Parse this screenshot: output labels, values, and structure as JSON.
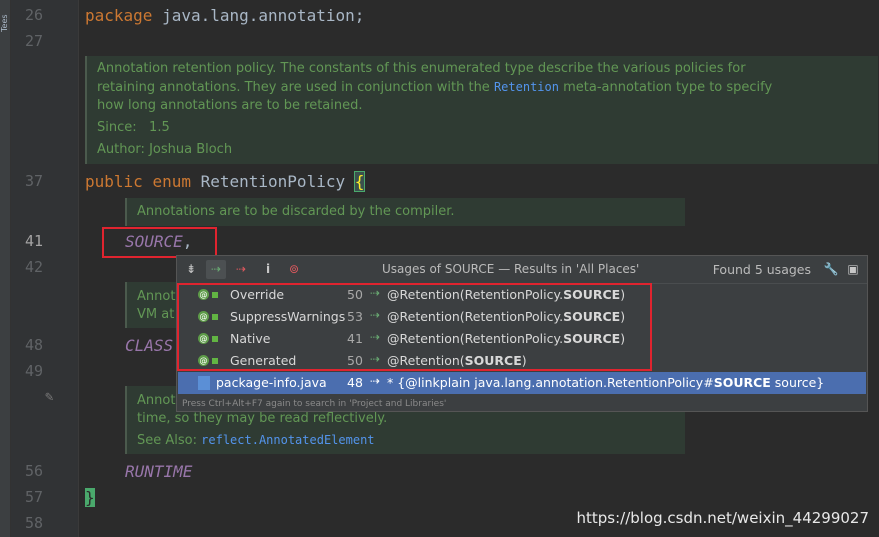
{
  "sidebar": {
    "vertical_label": "Tees"
  },
  "gutter": {
    "lines": [
      "26",
      "27",
      "37",
      "41",
      "42",
      "48",
      "49",
      "56",
      "57",
      "58"
    ]
  },
  "code": {
    "line26": {
      "kw": "package",
      "rest": " java.lang.annotation;"
    },
    "line37": {
      "kw1": "public",
      "kw2": "enum",
      "name": " RetentionPolicy ",
      "brace": "{"
    },
    "line41": {
      "const": "SOURCE",
      "comma": ","
    },
    "line48": {
      "const": "CLASS"
    },
    "line56": {
      "const": "RUNTIME"
    },
    "line57": {
      "brace": "}"
    }
  },
  "doc_main": {
    "p1_a": "Annotation retention policy. The constants of this enumerated type describe the various policies for",
    "p1_b_pre": "retaining annotations. They are used in conjunction with the ",
    "p1_b_link": "Retention",
    "p1_b_post": " meta-annotation type to specify",
    "p1_c": "how long annotations are to be retained.",
    "since_label": "Since:",
    "since_value": "1.5",
    "author_label": "Author:",
    "author_value": "Joshua Bloch"
  },
  "doc_source": {
    "text": "Annotations are to be discarded by the compiler."
  },
  "doc_class": {
    "a": "Annot",
    "b": "VM at"
  },
  "doc_runtime": {
    "a": "Annot",
    "b": "time, so they may be read reflectively.",
    "see_label": "See Also:",
    "see_link": "reflect.AnnotatedElement"
  },
  "popup": {
    "title": "Usages of SOURCE — Results in 'All Places'",
    "found": "Found 5 usages",
    "footer": "Press Ctrl+Alt+F7 again to search in 'Project and Libraries'",
    "rows": [
      {
        "name": "Override",
        "line": "50",
        "ref_pre": "@Retention(RetentionPolicy.",
        "ref_bold": "SOURCE",
        "ref_post": ")"
      },
      {
        "name": "SuppressWarnings",
        "line": "53",
        "ref_pre": "@Retention(RetentionPolicy.",
        "ref_bold": "SOURCE",
        "ref_post": ")"
      },
      {
        "name": "Native",
        "line": "41",
        "ref_pre": "@Retention(RetentionPolicy.",
        "ref_bold": "SOURCE",
        "ref_post": ")"
      },
      {
        "name": "Generated",
        "line": "50",
        "ref_pre": "@Retention(",
        "ref_bold": "SOURCE",
        "ref_post": ")"
      },
      {
        "name": "package-info.java",
        "line": "48",
        "ref_pre": "* {@linkplain java.lang.annotation.RetentionPolicy#",
        "ref_bold": "SOURCE",
        "ref_post": " source}"
      }
    ]
  },
  "watermark": "https://blog.csdn.net/weixin_44299027",
  "colors": {
    "background": "#2b2b2b",
    "keyword": "#cc7832",
    "constant": "#9876aa",
    "doc_text": "#629755",
    "highlight_border": "#e0242f",
    "selected_row": "#4b6eaf"
  }
}
